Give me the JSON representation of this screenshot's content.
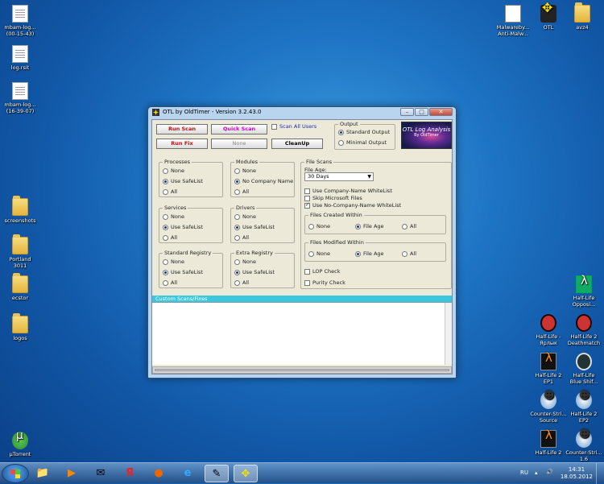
{
  "desktop": {
    "left_icons": [
      {
        "label": "mbam-log...\n(00-15-43)",
        "kind": "doc"
      },
      {
        "label": "log.rsit",
        "kind": "doc"
      },
      {
        "label": "mbam-log...\n(16-39-07)",
        "kind": "doc"
      },
      {
        "label": "screenshots",
        "kind": "folder"
      },
      {
        "label": "Portland\n3011",
        "kind": "folder"
      },
      {
        "label": "ecstor",
        "kind": "folder"
      },
      {
        "label": "logos",
        "kind": "folder"
      },
      {
        "label": "µTorrent",
        "kind": "utorrent"
      }
    ],
    "top_right_icons": [
      {
        "label": "Malwareby...\nAnti-Malw...",
        "kind": "app"
      },
      {
        "label": "OTL",
        "kind": "otl"
      },
      {
        "label": "avz4",
        "kind": "folder"
      }
    ],
    "right_icons": [
      {
        "label": "Half-Life\nOpposi...",
        "kind": "green"
      },
      {
        "label": "Half-Life -\nЯрлык",
        "kind": "hl"
      },
      {
        "label": "Half-Life 2\nDeathmatch",
        "kind": "hl2"
      },
      {
        "label": "Half-Life 2\nEP1",
        "kind": "hl2"
      },
      {
        "label": "Half-Life\nBlue Shif...",
        "kind": "hlbs"
      },
      {
        "label": "Counter-Stri...\nSource",
        "kind": "cs"
      },
      {
        "label": "Half-Life 2\nEP2",
        "kind": "hl2"
      },
      {
        "label": "Half-Life 2",
        "kind": "hl2"
      },
      {
        "label": "Counter-Stri...\n1.6",
        "kind": "cs"
      }
    ]
  },
  "window": {
    "title": "OTL by OldTimer - Version 3.2.43.0",
    "controls": {
      "minimize": "–",
      "maximize": "□",
      "close": "✕"
    },
    "buttons": {
      "run_scan": "Run Scan",
      "quick_scan": "Quick Scan",
      "run_fix": "Run Fix",
      "none": "None",
      "cleanup": "CleanUp"
    },
    "scan_all_users": "Scan All Users",
    "output": {
      "legend": "Output",
      "standard": "Standard Output",
      "minimal": "Minimal Output",
      "selected": "Standard Output"
    },
    "logo": {
      "line1": "OTL Log Analysis",
      "line2": "By OldTimer"
    },
    "processes": {
      "legend": "Processes",
      "options": [
        "None",
        "Use SafeList",
        "All"
      ],
      "selected": "Use SafeList"
    },
    "modules": {
      "legend": "Modules",
      "options": [
        "None",
        "No Company Name",
        "All"
      ],
      "selected": "No Company Name"
    },
    "services": {
      "legend": "Services",
      "options": [
        "None",
        "Use SafeList",
        "All"
      ],
      "selected": "Use SafeList"
    },
    "drivers": {
      "legend": "Drivers",
      "options": [
        "None",
        "Use SafeList",
        "All"
      ],
      "selected": "Use SafeList"
    },
    "standard_registry": {
      "legend": "Standard Registry",
      "options": [
        "None",
        "Use SafeList",
        "All"
      ],
      "selected": "Use SafeList"
    },
    "extra_registry": {
      "legend": "Extra Registry",
      "options": [
        "None",
        "Use SafeList",
        "All"
      ],
      "selected": "Use SafeList"
    },
    "file_scans": {
      "legend": "File Scans",
      "file_age_label": "File Age:",
      "file_age_value": "30 Days",
      "use_company_whitelist": "Use Company-Name WhiteList",
      "skip_microsoft": "Skip Microsoft Files",
      "use_no_company_whitelist": "Use No-Company-Name WhiteList",
      "created": {
        "legend": "Files Created Within",
        "options": [
          "None",
          "File Age",
          "All"
        ],
        "selected": "File Age"
      },
      "modified": {
        "legend": "Files Modified Within",
        "options": [
          "None",
          "File Age",
          "All"
        ],
        "selected": "File Age"
      },
      "lop_check": "LOP Check",
      "purity_check": "Purity Check"
    },
    "custom_scans_label": "Custom Scans/Fixes"
  },
  "taskbar": {
    "language": "RU",
    "time": "14:31",
    "date": "18.05.2012"
  }
}
